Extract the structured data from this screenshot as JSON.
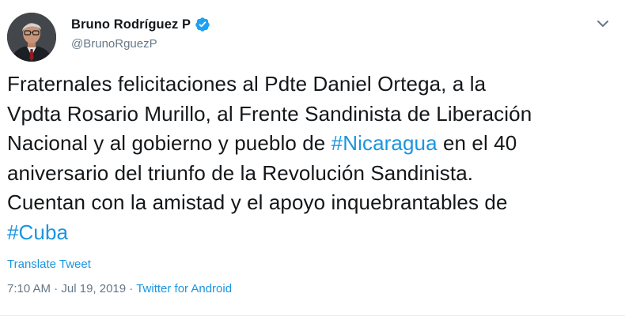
{
  "author": {
    "display_name": "Bruno Rodríguez P",
    "handle": "@BrunoRguezP",
    "verified": true,
    "avatar_icon": "profile-photo"
  },
  "tweet": {
    "text_segments": [
      {
        "type": "text",
        "value": "Fraternales felicitaciones al Pdte Daniel Ortega, a la\nVpdta Rosario Murillo, al Frente Sandinista de Liberación\nNacional y al gobierno y pueblo de "
      },
      {
        "type": "hashtag",
        "value": "#Nicaragua"
      },
      {
        "type": "text",
        "value": " en el 40\naniversario del triunfo de la Revolución Sandinista.\nCuentan con la amistad y el apoyo inquebrantables de\n"
      },
      {
        "type": "hashtag",
        "value": "#Cuba"
      }
    ],
    "translate_label": "Translate Tweet",
    "time": "7:10 AM",
    "date": "Jul 19, 2019",
    "separator": " · ",
    "source": "Twitter for Android"
  },
  "icons": {
    "verified": "verified-badge-icon",
    "menu": "chevron-down-icon"
  },
  "colors": {
    "link": "#1b95e0",
    "muted": "#657786",
    "text": "#14171a",
    "verified": "#1da1f2"
  }
}
